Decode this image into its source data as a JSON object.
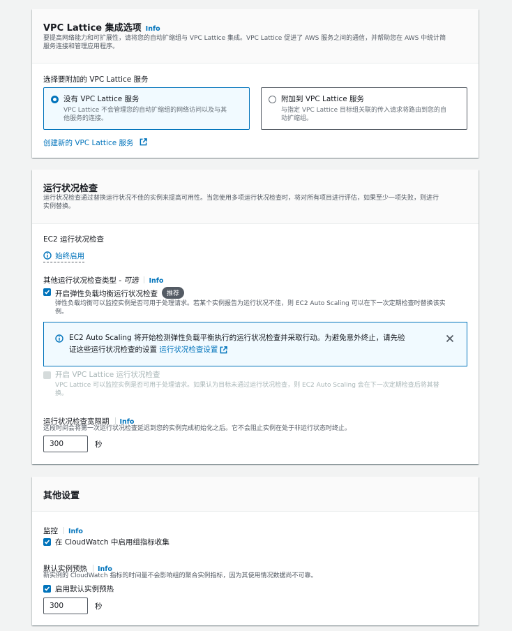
{
  "vpc": {
    "title": "VPC Lattice 集成选项",
    "info": "Info",
    "desc_line1": "要提高网络能力和可扩展性，请将您的自动扩缩组与 VPC Lattice 集成。VPC Lattice 促进了 AWS 服务之间的通信，并帮助您在 AWS 中统计简",
    "desc_line2": "服务连接和管理应用程序。",
    "select_label": "选择要附加的 VPC Lattice 服务",
    "option_none": {
      "label": "没有 VPC Lattice 服务",
      "desc_line1": "VPC Lattice 不会管理您的自动扩缩组的网络访问以及与其",
      "desc_line2": "他服务的连接。"
    },
    "option_attach": {
      "label": "附加到 VPC Lattice 服务",
      "desc_line1": "与指定 VPC Lattice 目标组关联的传入请求将路由到您的自",
      "desc_line2": "动扩缩组。"
    },
    "create_link": "创建新的 VPC Lattice 服务"
  },
  "health": {
    "title": "运行状况检查",
    "desc_line1": "运行状况检查通过替换运行状况不佳的实例来提高可用性。当您使用多项运行状况检查时，将对所有项目进行评估，如果至少一项失败，则进行",
    "desc_line2": "实例替换。",
    "ec2_label": "EC2 运行状况检查",
    "always_on": "始终启用",
    "other_label": "其他运行状况检查类型 - ",
    "optional": "可选",
    "info": "Info",
    "elb_label": "开启弹性负载均衡运行状况检查",
    "recommended": "推荐",
    "elb_desc_line1": "弹性负载均衡可以监控实例是否可用于处理请求。若某个实例报告为运行状况不佳，则 EC2 Auto Scaling 可以在下一次定期检查时替换该实",
    "elb_desc_line2": "例。",
    "alert_line1": "EC2 Auto Scaling 将开始检测弹性负载平衡执行的运行状况检查并采取行动。为避免意外终止，请先验",
    "alert_line2": "证这些运行状况检查的设置",
    "alert_link": "运行状况检查设置",
    "lattice_label": "开启 VPC Lattice 运行状况检查",
    "lattice_desc_line1": "VPC Lattice 可以监控实例是否可用于处理请求。如果认为目标未通过运行状况检查，则 EC2 Auto Scaling 会在下一次定期检查后将其替",
    "lattice_desc_line2": "换。",
    "grace_label": "运行状况检查宽限期",
    "grace_info": "Info",
    "grace_desc": "这段时间会将第一次运行状况检查延迟到您的实例完成初始化之后。它不会阻止实例在处于非运行状态时终止。",
    "grace_value": "300",
    "grace_unit": "秒"
  },
  "other": {
    "title": "其他设置",
    "monitor_label": "监控",
    "monitor_info": "Info",
    "cloudwatch_label": "在 CloudWatch 中启用组指标收集",
    "warmup_label": "默认实例预热",
    "warmup_info": "Info",
    "warmup_desc": "新实例的 CloudWatch 指标的时间量不会影响组的聚合实例指标，因为其使用情况数据尚不可靠。",
    "warmup_enable": "启用默认实例预热",
    "warmup_value": "300",
    "warmup_unit": "秒"
  },
  "colors": {
    "link": "#0073bb",
    "alert_bg": "#f1faff",
    "badge": "#545b64"
  }
}
